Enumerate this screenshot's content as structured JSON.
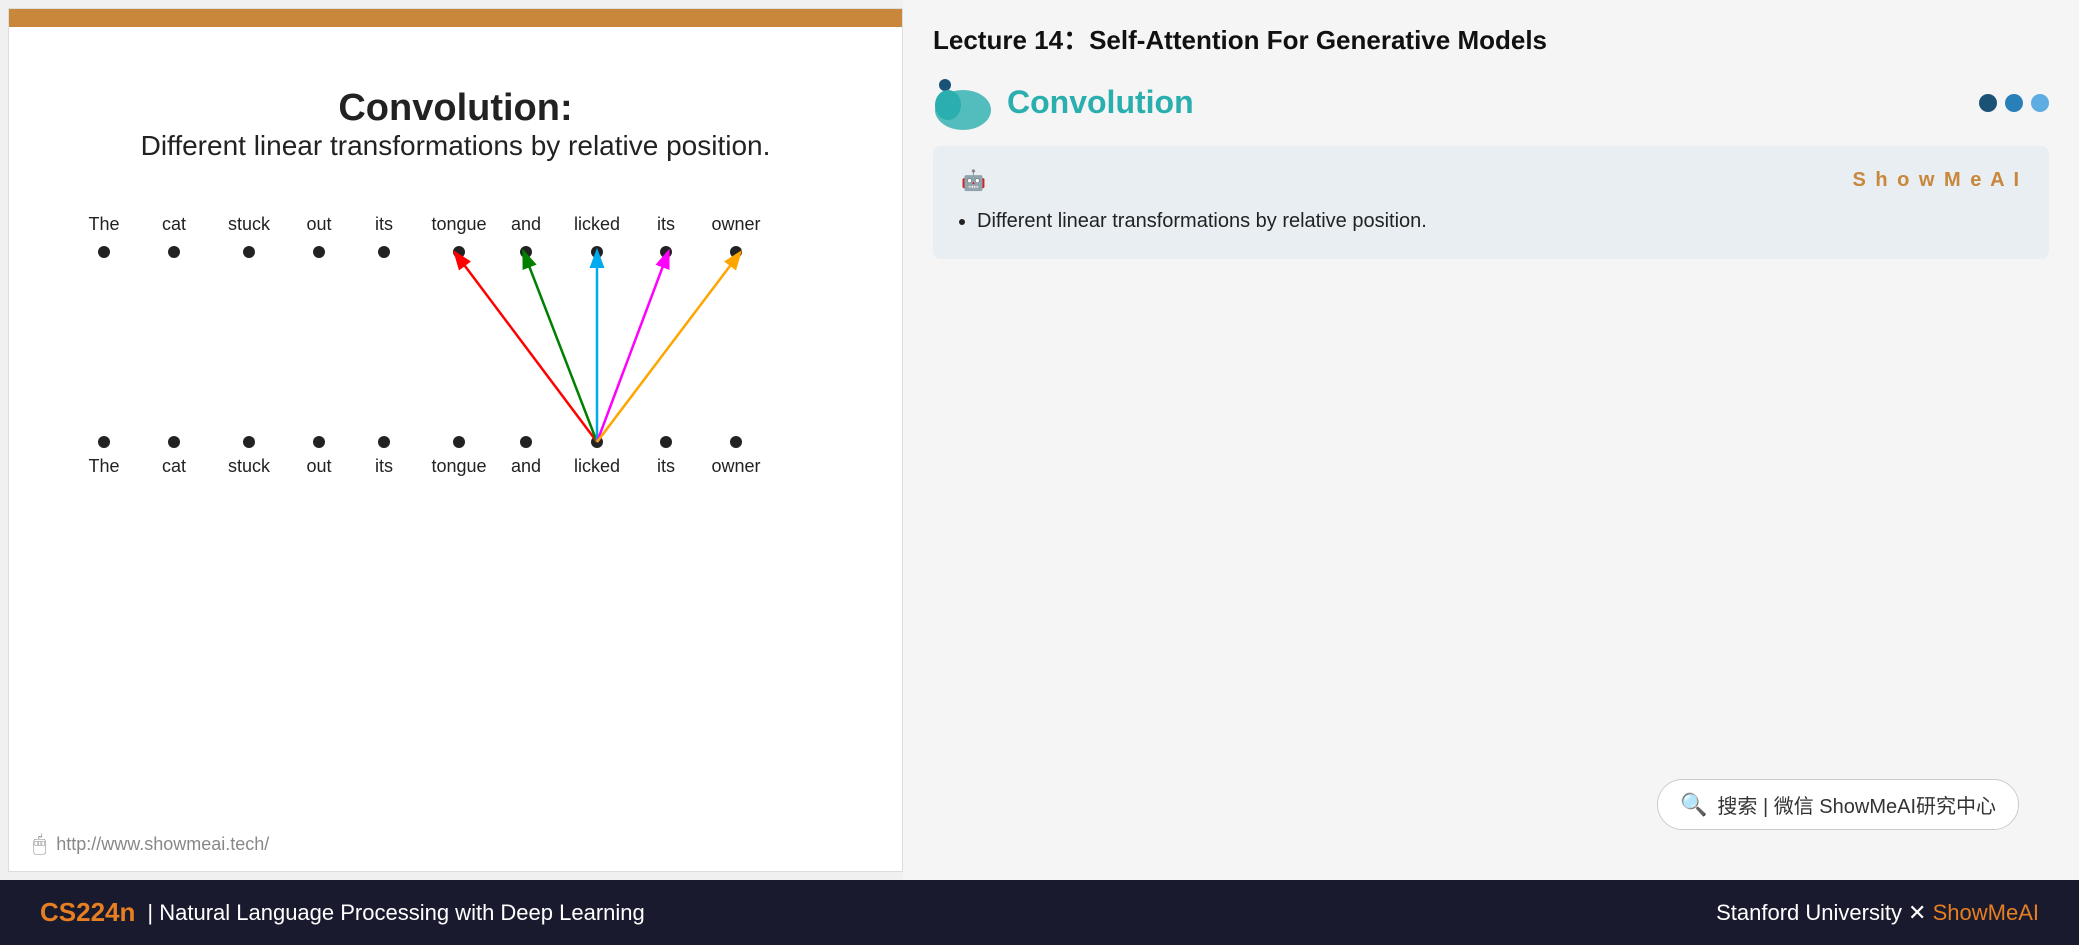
{
  "lecture": {
    "title": "Lecture 14：Self-Attention For Generative Models"
  },
  "slide": {
    "title": "Convolution:",
    "subtitle": "Different linear transformations by relative position.",
    "footer_url": "http://www.showmeai.tech/"
  },
  "section": {
    "name": "Convolution"
  },
  "notes": {
    "brand": "S h o w M e A I",
    "bullet1": "Different linear transformations by relative position."
  },
  "words_top": [
    "The",
    "cat",
    "stuck",
    "out",
    "its",
    "tongue",
    "and",
    "licked",
    "its",
    "owner"
  ],
  "words_bottom": [
    "The",
    "cat",
    "stuck",
    "out",
    "its",
    "tongue",
    "and",
    "licked",
    "its",
    "owner"
  ],
  "search": {
    "label": "搜索 | 微信 ShowMeAI研究中心"
  },
  "bottom_bar": {
    "course": "CS224n",
    "separator": " | Natural Language Processing with Deep Learning",
    "right": "Stanford University × ShowMeAI"
  },
  "nav_dots": [
    "filled",
    "filled",
    "outline"
  ]
}
